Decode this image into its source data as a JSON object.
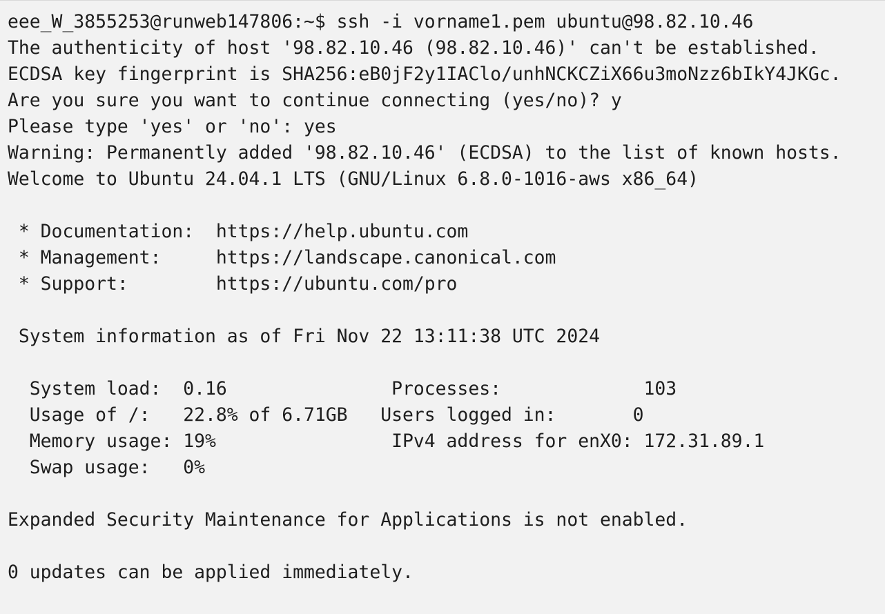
{
  "terminal": {
    "lines": [
      "eee_W_3855253@runweb147806:~$ ssh -i vorname1.pem ubuntu@98.82.10.46",
      "The authenticity of host '98.82.10.46 (98.82.10.46)' can't be established.",
      "ECDSA key fingerprint is SHA256:eB0jF2y1IAClo/unhNCKCZiX66u3moNzz6bIkY4JKGc.",
      "Are you sure you want to continue connecting (yes/no)? y",
      "Please type 'yes' or 'no': yes",
      "Warning: Permanently added '98.82.10.46' (ECDSA) to the list of known hosts.",
      "Welcome to Ubuntu 24.04.1 LTS (GNU/Linux 6.8.0-1016-aws x86_64)",
      "",
      " * Documentation:  https://help.ubuntu.com",
      " * Management:     https://landscape.canonical.com",
      " * Support:        https://ubuntu.com/pro",
      "",
      " System information as of Fri Nov 22 13:11:38 UTC 2024",
      "",
      "  System load:  0.16               Processes:             103",
      "  Usage of /:   22.8% of 6.71GB   Users logged in:       0",
      "  Memory usage: 19%                IPv4 address for enX0: 172.31.89.1",
      "  Swap usage:   0%",
      "",
      "Expanded Security Maintenance for Applications is not enabled.",
      "",
      "0 updates can be applied immediately."
    ]
  }
}
